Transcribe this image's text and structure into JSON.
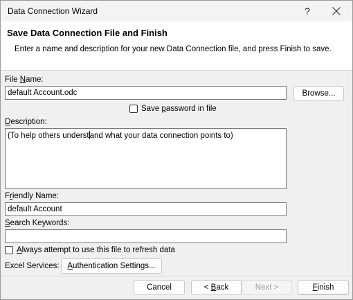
{
  "window": {
    "title": "Data Connection Wizard",
    "help_label": "?"
  },
  "header": {
    "title": "Save Data Connection File and Finish",
    "description": "Enter a name and description for your new Data Connection file, and press Finish to save."
  },
  "file_name": {
    "label_pre": "File ",
    "label_key": "N",
    "label_post": "ame:",
    "value": "default Account.odc",
    "browse_label": "Browse..."
  },
  "save_password": {
    "label_pre": "Save ",
    "label_key": "p",
    "label_post": "assword in file",
    "checked": false
  },
  "description": {
    "label_key": "D",
    "label_post": "escription:",
    "value_pre_caret": "(To help others underst",
    "value_post_caret": "and what your data connection points to)"
  },
  "friendly_name": {
    "label_pre": "F",
    "label_key": "r",
    "label_post": "iendly Name:",
    "value": "default Account"
  },
  "search_keywords": {
    "label_key": "S",
    "label_post": "earch Keywords:",
    "value": ""
  },
  "always_refresh": {
    "label_key": "A",
    "label_post": "lways attempt to use this file to refresh data",
    "checked": false
  },
  "excel_services": {
    "label": "Excel Services:",
    "auth_pre": "",
    "auth_key": "A",
    "auth_post": "uthentication Settings..."
  },
  "buttons": {
    "cancel": "Cancel",
    "back_pre": "< ",
    "back_key": "B",
    "back_post": "ack",
    "next": "Next >",
    "finish_key": "F",
    "finish_post": "inish"
  }
}
